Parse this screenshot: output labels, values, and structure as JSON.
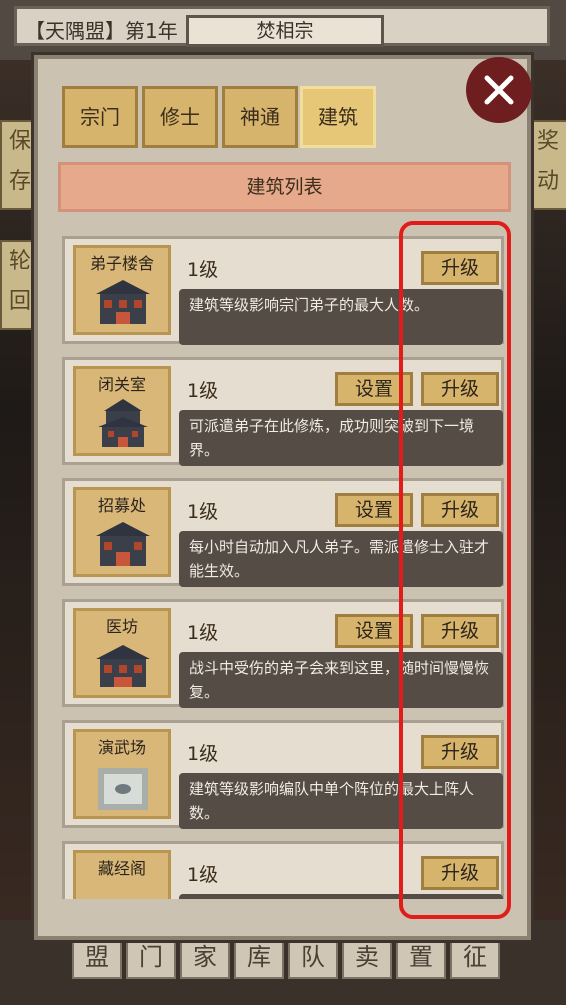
{
  "top": {
    "alliance_info": "【天隅盟】第1年",
    "sect_name": "焚相宗"
  },
  "side_buttons": {
    "left": [
      "保",
      "存",
      "轮",
      "回"
    ],
    "right": [
      "奖",
      "动"
    ]
  },
  "tabs": [
    {
      "label": "宗门",
      "active": false
    },
    {
      "label": "修士",
      "active": false
    },
    {
      "label": "神通",
      "active": false
    },
    {
      "label": "建筑",
      "active": true
    }
  ],
  "list_header": "建筑列表",
  "buildings": [
    {
      "name": "弟子楼舍",
      "level": "1级",
      "desc": "建筑等级影响宗门弟子的最大人数。",
      "has_set": false
    },
    {
      "name": "闭关室",
      "level": "1级",
      "desc": "可派遣弟子在此修炼，成功则突破到下一境界。",
      "has_set": true
    },
    {
      "name": "招募处",
      "level": "1级",
      "desc": "每小时自动加入凡人弟子。需派遣修士入驻才能生效。",
      "has_set": true
    },
    {
      "name": "医坊",
      "level": "1级",
      "desc": "战斗中受伤的弟子会来到这里，随时间慢慢恢复。",
      "has_set": true
    },
    {
      "name": "演武场",
      "level": "1级",
      "desc": "建筑等级影响编队中单个阵位的最大上阵人数。",
      "has_set": false
    },
    {
      "name": "藏经阁",
      "level": "1级",
      "desc": "",
      "has_set": false
    }
  ],
  "buttons": {
    "upgrade": "升级",
    "setting": "设置"
  },
  "bottom_tabs": [
    "盟",
    "门",
    "家",
    "库",
    "队",
    "卖",
    "置",
    "征"
  ],
  "colors": {
    "highlight": "#e21b1b",
    "close_bg": "#6e1e1e"
  }
}
